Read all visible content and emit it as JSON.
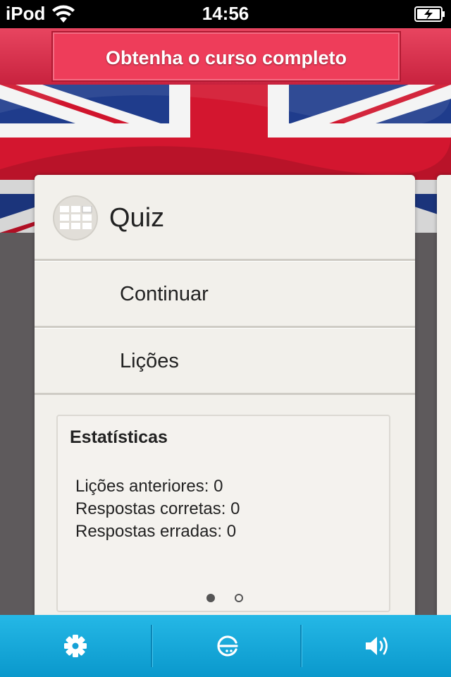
{
  "status_bar": {
    "carrier": "iPod",
    "time": "14:56",
    "icons": [
      "wifi-icon",
      "battery-charging-icon"
    ]
  },
  "promo": {
    "label": "Obtenha o curso completo"
  },
  "card": {
    "title": "Quiz",
    "icon": "quiz-grid-icon",
    "menu": [
      {
        "label": "Continuar"
      },
      {
        "label": "Lições"
      }
    ],
    "stats": {
      "title": "Estatísticas",
      "lines": [
        "Lições anteriores: 0",
        "Respostas corretas: 0",
        "Respostas erradas: 0"
      ]
    },
    "pagination": {
      "current": 1,
      "total": 2
    }
  },
  "toolbar": {
    "items": [
      "gear-icon",
      "dictionary-icon",
      "speaker-icon"
    ]
  },
  "colors": {
    "promo": "#ee3d5a",
    "toolbar": "#1aa9dc",
    "card": "#f2f0eb",
    "background": "#5e5a5c"
  }
}
